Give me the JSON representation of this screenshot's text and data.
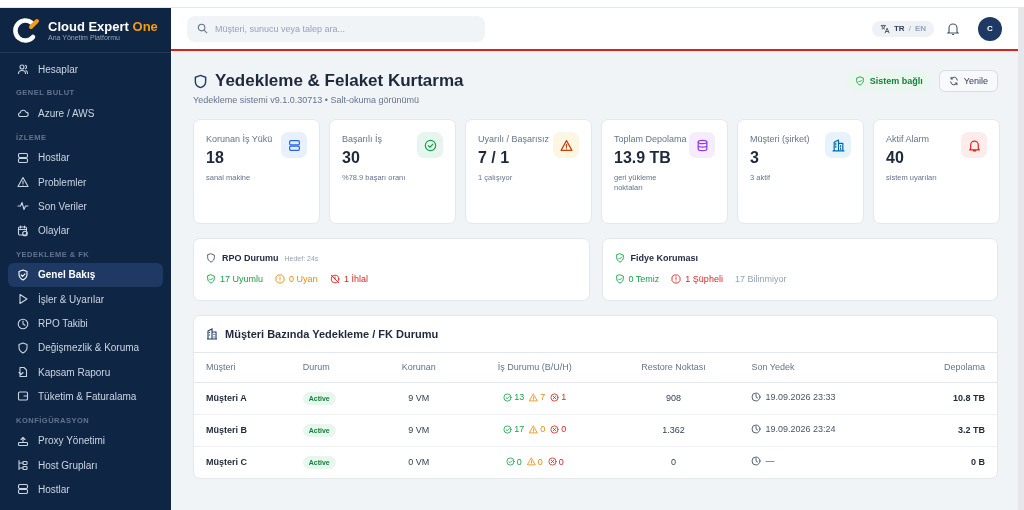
{
  "brand": {
    "name": "Cloud Expert",
    "accent": "One",
    "tagline": "Ana Yönetim Platformu"
  },
  "sidebar": {
    "sections": [
      {
        "items": [
          {
            "label": "Hesaplar",
            "selected": false
          }
        ]
      },
      {
        "heading": "GENEL BULUT",
        "items": [
          {
            "label": "Azure / AWS",
            "selected": false
          }
        ]
      },
      {
        "heading": "İZLEME",
        "items": [
          {
            "label": "Hostlar",
            "selected": false
          },
          {
            "label": "Problemler",
            "selected": false
          },
          {
            "label": "Son Veriler",
            "selected": false
          },
          {
            "label": "Olaylar",
            "selected": false
          }
        ]
      },
      {
        "heading": "YEDEKLEME & FK",
        "items": [
          {
            "label": "Genel Bakış",
            "selected": true
          },
          {
            "label": "İşler & Uyarılar",
            "selected": false
          },
          {
            "label": "RPO Takibi",
            "selected": false
          },
          {
            "label": "Değişmezlik & Koruma",
            "selected": false
          },
          {
            "label": "Kapsam Raporu",
            "selected": false
          },
          {
            "label": "Tüketim & Faturalama",
            "selected": false
          }
        ]
      },
      {
        "heading": "KONFİGÜRASYON",
        "items": [
          {
            "label": "Proxy Yönetimi",
            "selected": false
          },
          {
            "label": "Host Grupları",
            "selected": false
          },
          {
            "label": "Hostlar",
            "selected": false
          }
        ]
      }
    ]
  },
  "topbar": {
    "search": {
      "placeholder": "Müşteri, sunucu veya talep ara..."
    },
    "languages": [
      {
        "label": "TR",
        "selected": true
      },
      {
        "label": "EN",
        "selected": false
      }
    ],
    "lang_separator": "/",
    "avatar": "C"
  },
  "page": {
    "title": "Yedekleme & Felaket Kurtarma",
    "subtitle": "Yedekleme sistemi v9.1.0.30713 • Salt-okuma görünümü",
    "status": "Sistem bağlı",
    "refresh": "Yenile"
  },
  "stats": [
    {
      "label": "Korunan İş Yükü",
      "value": "18",
      "sub": "sanal makine"
    },
    {
      "label": "Başarılı İş",
      "value": "30",
      "sub": "%78.9 başarı oranı"
    },
    {
      "label": "Uyarılı / Başarısız",
      "value": "7 / 1",
      "sub": "1 çalışıyor"
    },
    {
      "label": "Toplam Depolama",
      "value": "13.9 TB",
      "sub": "geri yükleme noktaları"
    },
    {
      "label": "Müşteri (şirket)",
      "value": "3",
      "sub": "3 aktif"
    },
    {
      "label": "Aktif Alarm",
      "value": "40",
      "sub": "sistem uyarıları"
    }
  ],
  "panels": [
    {
      "title": "RPO Durumu",
      "hint": "Hedef: 24s",
      "items": [
        {
          "kind": "ok",
          "text": "17 Uyumlu"
        },
        {
          "kind": "warn",
          "text": "0 Uyarı"
        },
        {
          "kind": "breach",
          "text": "1 İhlal"
        }
      ]
    },
    {
      "title": "Fidye Koruması",
      "items": [
        {
          "kind": "ok",
          "text": "0 Temiz"
        },
        {
          "kind": "alert",
          "text": "1 Şüpheli"
        },
        {
          "kind": "muted",
          "text": "17 Bilinmiyor"
        }
      ]
    }
  ],
  "table": {
    "title": "Müşteri Bazında Yedekleme / FK Durumu",
    "columns": [
      "Müşteri",
      "Durum",
      "Korunan",
      "İş Durumu (B/U/H)",
      "Restore Noktası",
      "Son Yedek",
      "Depolama"
    ],
    "rows": [
      {
        "customer": "Müşteri A",
        "status": "Active",
        "protected": "9 VM",
        "ok": "13",
        "warn": "7",
        "fail": "1",
        "restore": "908",
        "last": "19.09.2026 23:33",
        "storage": "10.8 TB"
      },
      {
        "customer": "Müşteri B",
        "status": "Active",
        "protected": "9 VM",
        "ok": "17",
        "warn": "0",
        "fail": "0",
        "restore": "1.362",
        "last": "19.09.2026 23:24",
        "storage": "3.2 TB"
      },
      {
        "customer": "Müşteri C",
        "status": "Active",
        "protected": "0 VM",
        "ok": "0",
        "warn": "0",
        "fail": "0",
        "restore": "0",
        "last": "—",
        "storage": "0 B"
      }
    ]
  }
}
